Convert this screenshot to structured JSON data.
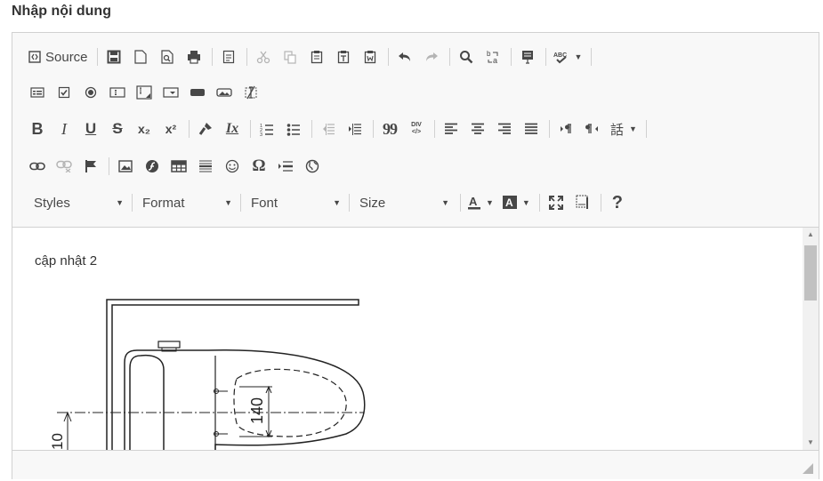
{
  "heading": "Nhập nội dung",
  "toolbar": {
    "source_label": "Source",
    "combos": {
      "styles": "Styles",
      "format": "Format",
      "font": "Font",
      "size": "Size"
    },
    "format_glyphs": {
      "bold": "B",
      "italic": "I",
      "underline": "U",
      "strike": "S",
      "subscript": "x₂",
      "superscript": "x²",
      "remove_format": "Ix",
      "blockquote": "99",
      "div": "DIV",
      "omega": "Ω",
      "help": "?",
      "language": "話"
    }
  },
  "content": {
    "text": "cập nhật 2",
    "drawing_labels": {
      "dimension": "140",
      "side_dimension": "10"
    }
  },
  "colors": {
    "toolbar_bg": "#f8f8f8",
    "border": "#d1d1d1",
    "icon": "#474747"
  }
}
